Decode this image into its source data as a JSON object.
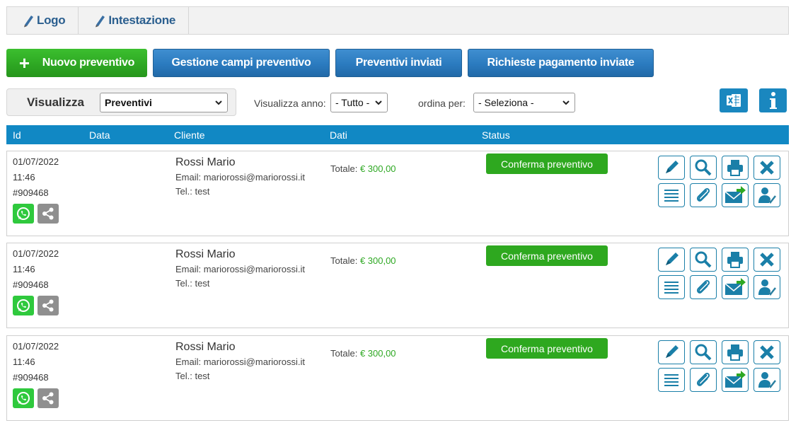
{
  "top_tabs": [
    {
      "label": "Logo"
    },
    {
      "label": "Intestazione"
    }
  ],
  "actions": {
    "new_quote": "Nuovo preventivo",
    "manage_fields": "Gestione campi preventivo",
    "sent_quotes": "Preventivi inviati",
    "payment_requests": "Richieste pagamento inviate"
  },
  "filters": {
    "view_label": "Visualizza",
    "view_value": "Preventivi",
    "year_label": "Visualizza anno:",
    "year_value": "- Tutto -",
    "order_label": "ordina per:",
    "order_value": "- Seleziona -"
  },
  "table": {
    "headers": [
      "Id",
      "Data",
      "Cliente",
      "Dati",
      "Status"
    ]
  },
  "rows": [
    {
      "date": "01/07/2022",
      "time": "11:46",
      "id": "#909468",
      "name": "Rossi Mario",
      "email": "Email: mariorossi@mariorossi.it",
      "tel": "Tel.: test",
      "total_label": "Totale:",
      "total_value": "€ 300,00",
      "status": "Conferma preventivo"
    },
    {
      "date": "01/07/2022",
      "time": "11:46",
      "id": "#909468",
      "name": "Rossi Mario",
      "email": "Email: mariorossi@mariorossi.it",
      "tel": "Tel.: test",
      "total_label": "Totale:",
      "total_value": "€ 300,00",
      "status": "Conferma preventivo"
    },
    {
      "date": "01/07/2022",
      "time": "11:46",
      "id": "#909468",
      "name": "Rossi Mario",
      "email": "Email: mariorossi@mariorossi.it",
      "tel": "Tel.: test",
      "total_label": "Totale:",
      "total_value": "€ 300,00",
      "status": "Conferma preventivo"
    }
  ],
  "icons": {
    "tabs": "pencil-icon",
    "excel": "excel-icon",
    "info": "info-icon",
    "row_actions": [
      "pencil-icon",
      "magnifier-icon",
      "printer-icon",
      "close-icon",
      "list-icon",
      "paperclip-icon",
      "send-mail-icon",
      "user-check-icon"
    ],
    "row_social": [
      "whatsapp-icon",
      "share-icon"
    ]
  },
  "colors": {
    "green": "#2ea823",
    "blue": "#1188c4",
    "tab_text": "#2b5f8f"
  }
}
